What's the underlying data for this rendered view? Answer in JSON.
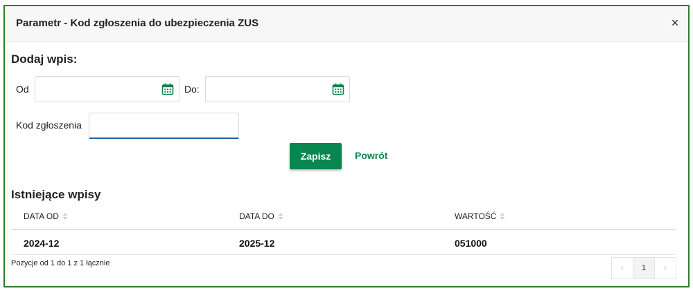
{
  "dialog": {
    "title": "Parametr - Kod zgłoszenia do ubezpieczenia ZUS",
    "close_glyph": "×"
  },
  "add_section": {
    "title": "Dodaj wpis:",
    "from_label": "Od",
    "from_value": "",
    "to_label": "Do:",
    "to_value": "",
    "code_label": "Kod zgłoszenia",
    "code_value": "",
    "calendar_icon": "calendar-icon",
    "save_label": "Zapisz",
    "back_label": "Powrót"
  },
  "existing_section": {
    "title": "Istniejące wpisy",
    "columns": [
      "DATA OD",
      "DATA DO",
      "WARTOŚĆ"
    ],
    "rows": [
      [
        "2024-12",
        "2025-12",
        "051000"
      ]
    ]
  },
  "pagination": {
    "info": "Pozycje od 1 do 1 z 1 łącznie",
    "prev_glyph": "‹",
    "current_page": "1",
    "next_glyph": "›"
  },
  "colors": {
    "accent": "#08864f",
    "frame": "#2e7d32",
    "input_focus": "#1a5fa8"
  }
}
